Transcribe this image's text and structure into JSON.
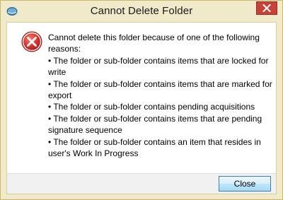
{
  "window": {
    "title": "Cannot Delete Folder",
    "app_icon": "app-logo-icon",
    "close_icon": "close-icon"
  },
  "dialog": {
    "icon": "error-icon",
    "lines": [
      "Cannot delete this folder because of one of the following reasons:",
      "• The folder or sub-folder contains items that are locked for write",
      "• The folder or sub-folder contains items that are marked for export",
      "• The folder or sub-folder contains pending acquisitions",
      "• The folder or sub-folder contains items that are pending signature sequence",
      "• The folder or sub-folder contains an item that resides in user's Work In Progress"
    ],
    "close_label": "Close"
  },
  "colors": {
    "frame": "#f0eaca",
    "close_x": "#c7433a",
    "error_red": "#d9302b",
    "button_border": "#3c7fb1"
  }
}
